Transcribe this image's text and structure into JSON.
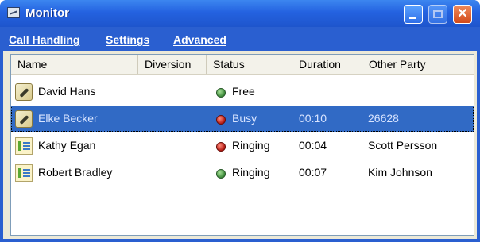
{
  "window": {
    "title": "Monitor",
    "icon": "monitor-app-icon"
  },
  "menu": [
    "Call Handling",
    "Settings",
    "Advanced"
  ],
  "columns": [
    "Name",
    "Diversion",
    "Status",
    "Duration",
    "Other Party"
  ],
  "rows": [
    {
      "icon": "phone-icon",
      "name": "David Hans",
      "diversion": "",
      "status_color": "green",
      "status": "Free",
      "duration": "",
      "other_party": "",
      "selected": false
    },
    {
      "icon": "phone-icon",
      "name": "Elke Becker",
      "diversion": "",
      "status_color": "red",
      "status": "Busy",
      "duration": "00:10",
      "other_party": "26628",
      "selected": true
    },
    {
      "icon": "queue-icon",
      "name": "Kathy Egan",
      "diversion": "",
      "status_color": "red",
      "status": "Ringing",
      "duration": "00:04",
      "other_party": "Scott Persson",
      "selected": false
    },
    {
      "icon": "queue-icon",
      "name": "Robert Bradley",
      "diversion": "",
      "status_color": "green",
      "status": "Ringing",
      "duration": "00:07",
      "other_party": "Kim Johnson",
      "selected": false
    }
  ],
  "colors": {
    "titlebar": "#2462e0",
    "selection": "#316ac5",
    "status_green": "#3c8a3a",
    "status_red": "#b51a12"
  }
}
